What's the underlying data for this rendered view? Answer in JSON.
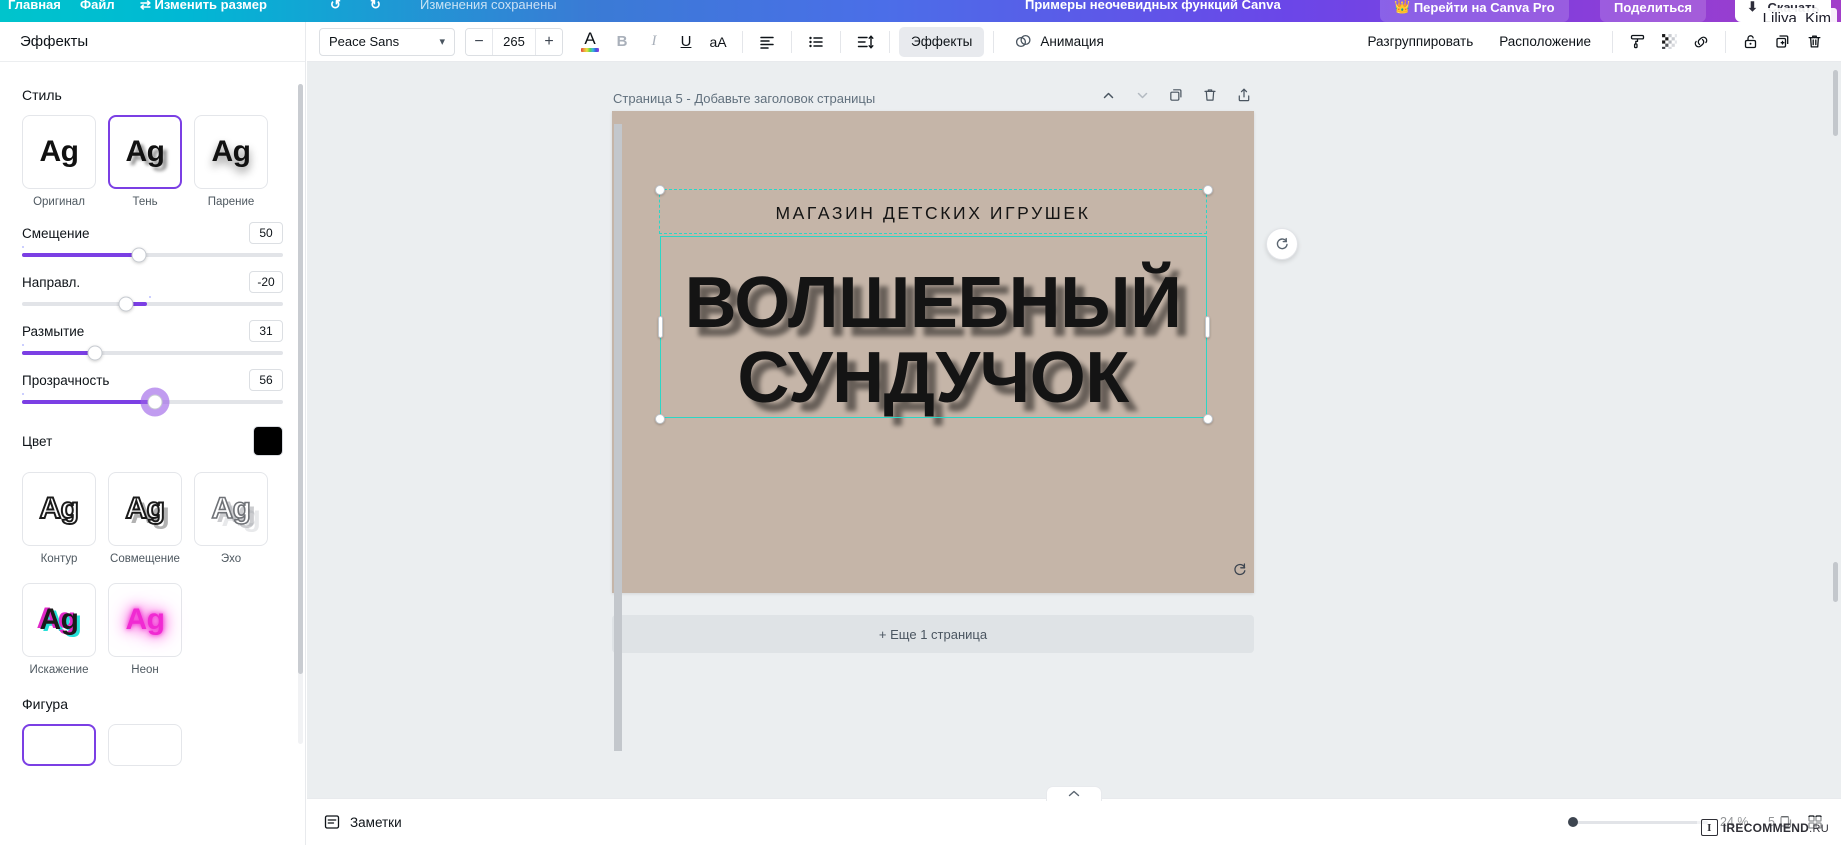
{
  "topbar": {
    "menu_file": "Файл",
    "menu_resize": "Изменить размер",
    "undo_icon": "undo-icon",
    "redo_icon": "redo-icon",
    "autosave_status": "Изменения сохранены",
    "doc_title": "Примеры неочевидных функций Canva",
    "pro_button": "Перейти на Canva Pro",
    "share_button": "Поделиться",
    "download_button": "Скачать",
    "user_name": "Liliya_Kim"
  },
  "sidebar": {
    "header": "Эффекты",
    "style_section": "Стиль",
    "style_presets": [
      {
        "label": "Оригинал",
        "glyph": "Ag",
        "style": "original",
        "selected": false
      },
      {
        "label": "Тень",
        "glyph": "Ag",
        "style": "shadow",
        "selected": true
      },
      {
        "label": "Парение",
        "glyph": "Ag",
        "style": "lift",
        "selected": false
      }
    ],
    "sliders": [
      {
        "label": "Смещение",
        "value": "50",
        "fill_pct": 45,
        "active": false,
        "reverse": false
      },
      {
        "label": "Направл.",
        "value": "-20",
        "fill_pct": 40,
        "active": false,
        "reverse": true
      },
      {
        "label": "Размытие",
        "value": "31",
        "fill_pct": 28,
        "active": false,
        "reverse": false
      },
      {
        "label": "Прозрачность",
        "value": "56",
        "fill_pct": 51,
        "active": true,
        "reverse": false
      }
    ],
    "color_label": "Цвет",
    "color_value": "#000000",
    "more_presets": [
      {
        "label": "Контур",
        "glyph": "Ag",
        "style": "hollow"
      },
      {
        "label": "Совмещение",
        "glyph": "Ag",
        "style": "splice"
      },
      {
        "label": "Эхо",
        "glyph": "Ag",
        "style": "echo"
      },
      {
        "label": "Искажение",
        "glyph": "Ag",
        "style": "glitch"
      },
      {
        "label": "Неон",
        "glyph": "Ag",
        "style": "neon"
      }
    ],
    "shape_section": "Фигура"
  },
  "toolbar": {
    "font_family": "Peace Sans",
    "font_size": "265",
    "decrease_label": "−",
    "increase_label": "+",
    "text_color_glyph": "A",
    "bold_glyph": "B",
    "italic_glyph": "I",
    "underline_glyph": "U",
    "case_glyph": "aA",
    "align_icon": "align-left-icon",
    "list_icon": "bullet-list-icon",
    "spacing_icon": "line-spacing-icon",
    "effects_label": "Эффекты",
    "animation_label": "Анимация",
    "ungroup_label": "Разгруппировать",
    "position_label": "Расположение",
    "paint_icon": "paint-roller-icon",
    "transparency_icon": "transparency-icon",
    "link_icon": "link-icon",
    "lock_icon": "lock-icon",
    "duplicate_icon": "duplicate-icon",
    "delete_icon": "trash-icon"
  },
  "canvas": {
    "page_title": "Страница 5 - Добавьте заголовок страницы",
    "page_up_icon": "chevron-up-icon",
    "page_down_icon": "chevron-down-icon",
    "page_duplicate_icon": "duplicate-page-icon",
    "page_delete_icon": "trash-page-icon",
    "page_export_icon": "export-page-icon",
    "background_color": "#c5b5a8",
    "kicker_text": "МАГАЗИН ДЕТСКИХ ИГРУШЕК",
    "headline_line1": "ВОЛШЕБНЫЙ",
    "headline_line2": "СУНДУЧОК",
    "rotate_icon": "rotate-icon",
    "float_button_icon": "comment-icon",
    "add_page_label": "+ Еще 1 страница"
  },
  "bottombar": {
    "notes_label": "Заметки",
    "notes_icon": "notes-icon",
    "collapse_icon": "chevron-up-icon",
    "zoom_percent": "24 %",
    "zoom_slider_pct": 2,
    "page_count": "5",
    "grid_icon": "grid-view-icon"
  },
  "watermark": {
    "mark": "I",
    "brand": "IRECOMMEND",
    "suffix": ".RU"
  },
  "colors": {
    "accent_purple": "#7b3fe4",
    "selection_teal": "#2bd6c6",
    "canvas_bg": "#ebeef0",
    "page_bg": "#c5b5a8"
  }
}
